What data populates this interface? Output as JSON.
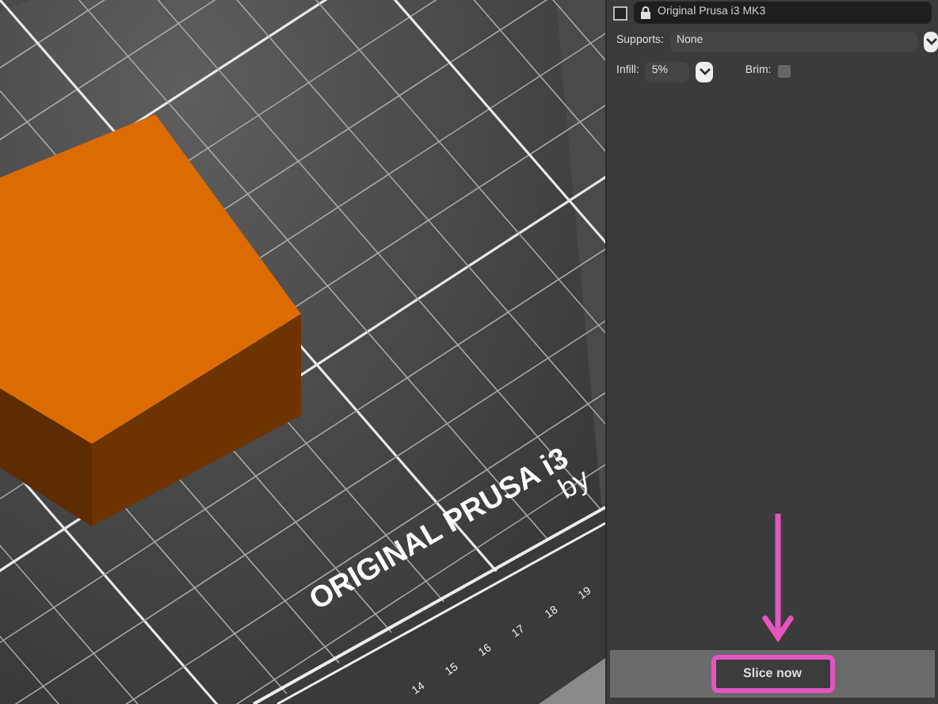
{
  "viewport": {
    "bed_logo": "ORIGINAL PRUSA i3",
    "bed_byline": "by",
    "axis_ticks": [
      "14",
      "15",
      "16",
      "17",
      "18",
      "19"
    ]
  },
  "sidebar": {
    "printer": {
      "value": "Original Prusa i3 MK3",
      "locked": true
    },
    "supports": {
      "label": "Supports:",
      "value": "None"
    },
    "infill": {
      "label": "Infill:",
      "value": "5%"
    },
    "brim": {
      "label": "Brim:",
      "checked": false
    },
    "slice_button": {
      "label": "Slice now",
      "highlighted": true
    }
  }
}
